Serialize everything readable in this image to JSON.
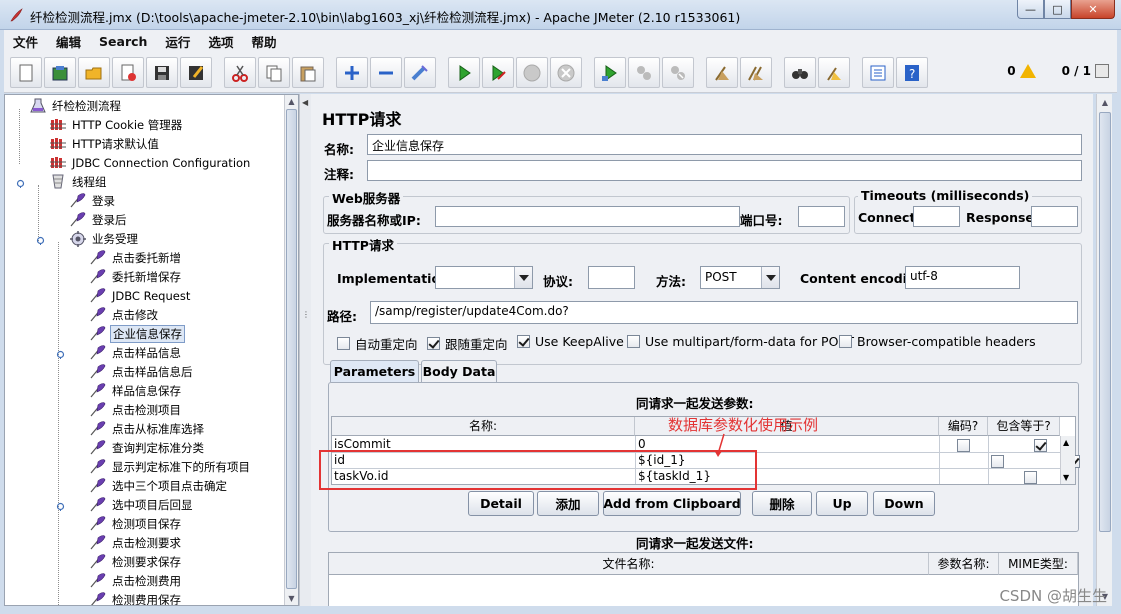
{
  "window": {
    "title": "纤检检测流程.jmx (D:\\tools\\apache-jmeter-2.10\\bin\\labg1603_xj\\纤检检测流程.jmx) - Apache JMeter (2.10 r1533061)"
  },
  "menu": [
    "文件",
    "编辑",
    "Search",
    "运行",
    "选项",
    "帮助"
  ],
  "toolbar": {
    "icons": [
      "new-icon",
      "templates-icon",
      "open-icon",
      "close-file-icon",
      "save-icon",
      "save-as-icon",
      "cut-icon",
      "copy-icon",
      "paste-icon",
      "expand-icon",
      "collapse-icon",
      "toggle-icon",
      "start-icon",
      "start-no-pause-icon",
      "stop-icon",
      "shutdown-icon",
      "remote-start-icon",
      "remote-stop-icon",
      "remote-shutdown-icon",
      "clear-icon",
      "clear-all-icon",
      "search-icon",
      "reset-search-icon",
      "function-helper-icon",
      "help-icon"
    ],
    "error_count": "0",
    "threads": "0 / 1"
  },
  "tree": {
    "items": [
      {
        "label": "纤检检测流程",
        "icon": "test-plan-icon",
        "level": 0,
        "selected": false
      },
      {
        "label": "HTTP Cookie 管理器",
        "icon": "config-element-icon",
        "level": 1,
        "selected": false
      },
      {
        "label": "HTTP请求默认值",
        "icon": "config-element-icon",
        "level": 1,
        "selected": false
      },
      {
        "label": "JDBC Connection Configuration",
        "icon": "config-element-icon",
        "level": 1,
        "selected": false
      },
      {
        "label": "线程组",
        "icon": "thread-group-icon",
        "level": 1,
        "selected": false
      },
      {
        "label": "登录",
        "icon": "sampler-icon",
        "level": 2,
        "selected": false
      },
      {
        "label": "登录后",
        "icon": "sampler-icon",
        "level": 2,
        "selected": false
      },
      {
        "label": "业务受理",
        "icon": "controller-icon",
        "level": 2,
        "selected": false
      },
      {
        "label": "点击委托新增",
        "icon": "sampler-icon",
        "level": 3,
        "selected": false
      },
      {
        "label": "委托新增保存",
        "icon": "sampler-icon",
        "level": 3,
        "selected": false
      },
      {
        "label": "JDBC Request",
        "icon": "sampler-icon",
        "level": 3,
        "selected": false
      },
      {
        "label": "点击修改",
        "icon": "sampler-icon",
        "level": 3,
        "selected": false
      },
      {
        "label": "企业信息保存",
        "icon": "sampler-icon",
        "level": 3,
        "selected": true
      },
      {
        "label": "点击样品信息",
        "icon": "sampler-icon",
        "level": 3,
        "selected": false
      },
      {
        "label": "点击样品信息后",
        "icon": "sampler-icon",
        "level": 3,
        "selected": false
      },
      {
        "label": "样品信息保存",
        "icon": "sampler-icon",
        "level": 3,
        "selected": false
      },
      {
        "label": "点击检测项目",
        "icon": "sampler-icon",
        "level": 3,
        "selected": false
      },
      {
        "label": "点击从标准库选择",
        "icon": "sampler-icon",
        "level": 3,
        "selected": false
      },
      {
        "label": "查询判定标准分类",
        "icon": "sampler-icon",
        "level": 3,
        "selected": false
      },
      {
        "label": "显示判定标准下的所有项目",
        "icon": "sampler-icon",
        "level": 3,
        "selected": false
      },
      {
        "label": "选中三个项目点击确定",
        "icon": "sampler-icon",
        "level": 3,
        "selected": false
      },
      {
        "label": "选中项目后回显",
        "icon": "sampler-icon",
        "level": 3,
        "selected": false
      },
      {
        "label": "检测项目保存",
        "icon": "sampler-icon",
        "level": 3,
        "selected": false
      },
      {
        "label": "点击检测要求",
        "icon": "sampler-icon",
        "level": 3,
        "selected": false
      },
      {
        "label": "检测要求保存",
        "icon": "sampler-icon",
        "level": 3,
        "selected": false
      },
      {
        "label": "点击检测费用",
        "icon": "sampler-icon",
        "level": 3,
        "selected": false
      },
      {
        "label": "检测费用保存",
        "icon": "sampler-icon",
        "level": 3,
        "selected": false
      }
    ]
  },
  "panel": {
    "title": "HTTP请求",
    "name_label": "名称:",
    "name_value": "企业信息保存",
    "comment_label": "注释:",
    "comment_value": "",
    "web_server": {
      "title": "Web服务器",
      "server_label": "服务器名称或IP:",
      "server_value": "",
      "port_label": "端口号:",
      "port_value": ""
    },
    "timeouts": {
      "title": "Timeouts (milliseconds)",
      "connect_label": "Connect:",
      "connect_value": "",
      "response_label": "Response:",
      "response_value": ""
    },
    "http_request": {
      "title": "HTTP请求",
      "implementation_label": "Implementation:",
      "implementation_value": "",
      "protocol_label": "协议:",
      "protocol_value": "",
      "method_label": "方法:",
      "method_value": "POST",
      "encoding_label": "Content encoding:",
      "encoding_value": "utf-8",
      "path_label": "路径:",
      "path_value": "/samp/register/update4Com.do?"
    },
    "options": [
      {
        "label": "自动重定向",
        "checked": false
      },
      {
        "label": "跟随重定向",
        "checked": true
      },
      {
        "label": "Use KeepAlive",
        "checked": true
      },
      {
        "label": "Use multipart/form-data for POST",
        "checked": false
      },
      {
        "label": "Browser-compatible headers",
        "checked": false
      }
    ],
    "tabs": [
      "Parameters",
      "Body Data"
    ],
    "params_title": "同请求一起发送参数:",
    "params_columns": [
      "名称:",
      "值",
      "编码?",
      "包含等于?"
    ],
    "params_rows": [
      {
        "name": "isCommit",
        "value": "0",
        "encode": false,
        "include_equals": true
      },
      {
        "name": "id",
        "value": "${id_1}",
        "encode": false,
        "include_equals": true
      },
      {
        "name": "taskVo.id",
        "value": "${taskId_1}",
        "encode": false,
        "include_equals": true
      }
    ],
    "param_buttons": [
      "Detail",
      "添加",
      "Add from Clipboard",
      "删除",
      "Up",
      "Down"
    ],
    "files_title": "同请求一起发送文件:",
    "files_columns": [
      "文件名称:",
      "参数名称:",
      "MIME类型:"
    ]
  },
  "annotation": {
    "text": "数据库参数化使用示例",
    "color": "#e33434"
  },
  "watermark": "CSDN @胡生生"
}
